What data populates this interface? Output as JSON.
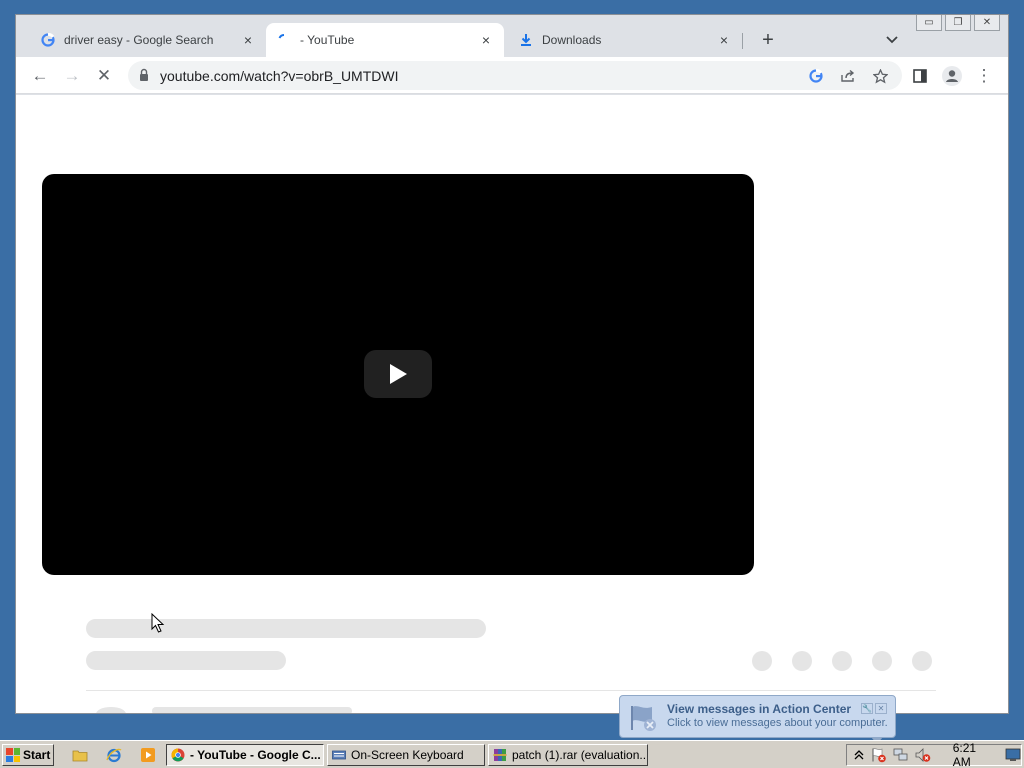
{
  "browser": {
    "tabs": [
      {
        "title": "driver easy - Google Search",
        "favicon": "google-g-icon",
        "active": false
      },
      {
        "title": "- YouTube",
        "favicon": "loading-spinner-icon",
        "active": true
      },
      {
        "title": "Downloads",
        "favicon": "download-icon",
        "active": false
      }
    ],
    "new_tab_symbol": "+",
    "tab_search_symbol": "⌄",
    "close_symbol": "×",
    "window_controls": {
      "minimize": "▭",
      "maximize": "❐",
      "close": "✕"
    },
    "toolbar": {
      "back": "←",
      "forward": "→",
      "stop": "✕",
      "url": "youtube.com/watch?v=obrB_UMTDWI",
      "menu": "⋮"
    }
  },
  "taskbar": {
    "start_label": "Start",
    "tasks": [
      {
        "label": "- YouTube - Google C...",
        "icon": "chrome-icon",
        "active": true
      },
      {
        "label": "On-Screen Keyboard",
        "icon": "keyboard-icon",
        "active": false
      },
      {
        "label": "patch (1).rar (evaluation...",
        "icon": "winrar-icon",
        "active": false
      }
    ],
    "clock": "6:21 AM"
  },
  "notification": {
    "title": "View messages in Action Center",
    "text": "Click to view messages about your computer."
  },
  "colors": {
    "desktop": "#3a6ea5",
    "video_bg": "#000000",
    "play_button": "#212121",
    "skeleton": "#e5e5e5"
  }
}
